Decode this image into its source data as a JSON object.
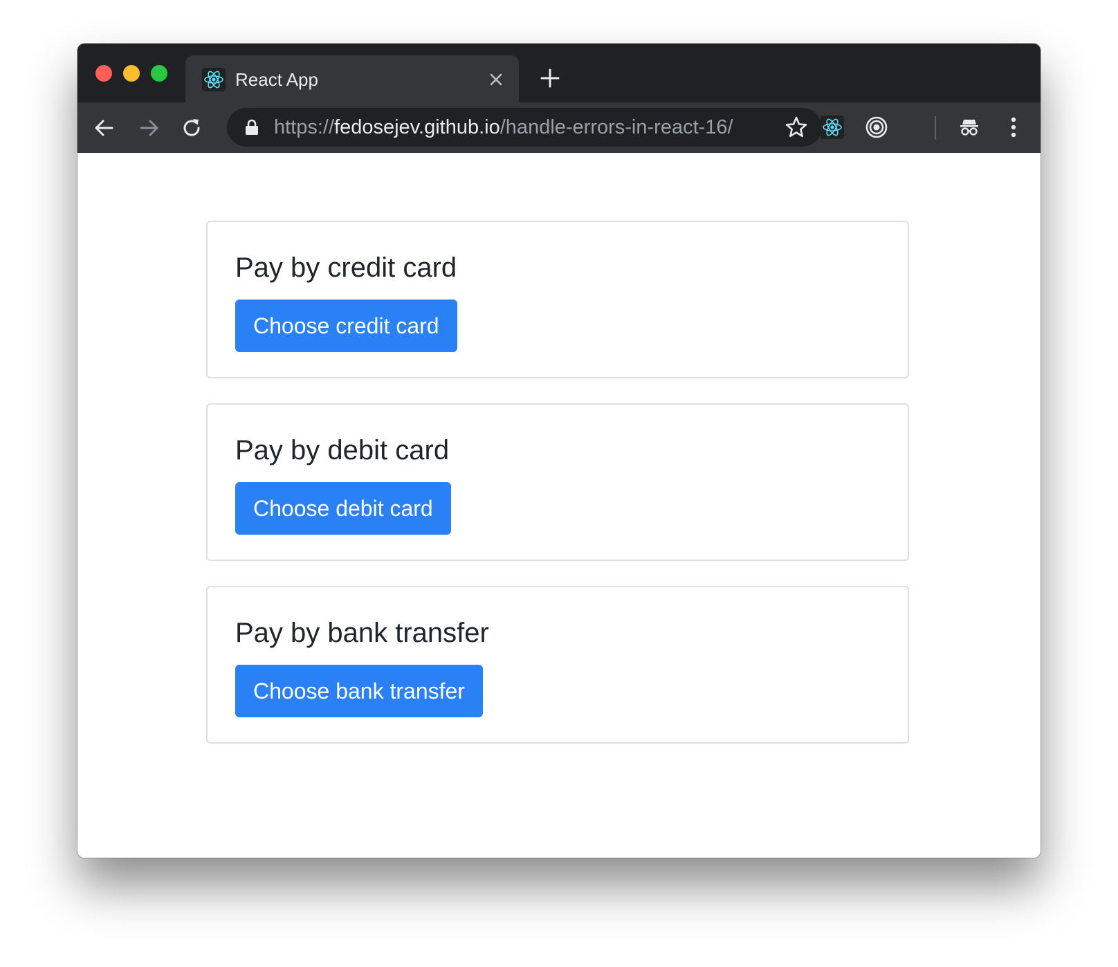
{
  "browser": {
    "tab": {
      "title": "React App",
      "favicon_icon": "react-icon"
    },
    "address_bar": {
      "scheme": "https://",
      "host": "fedosejev.github.io",
      "path": "/handle-errors-in-react-16/"
    }
  },
  "page": {
    "cards": [
      {
        "title": "Pay by credit card",
        "button_label": "Choose credit card"
      },
      {
        "title": "Pay by debit card",
        "button_label": "Choose debit card"
      },
      {
        "title": "Pay by bank transfer",
        "button_label": "Choose bank transfer"
      }
    ]
  },
  "colors": {
    "button_blue": "#2a81f6",
    "tab_strip": "#202124",
    "toolbar": "#35363a",
    "react_cyan": "#61dafb"
  }
}
